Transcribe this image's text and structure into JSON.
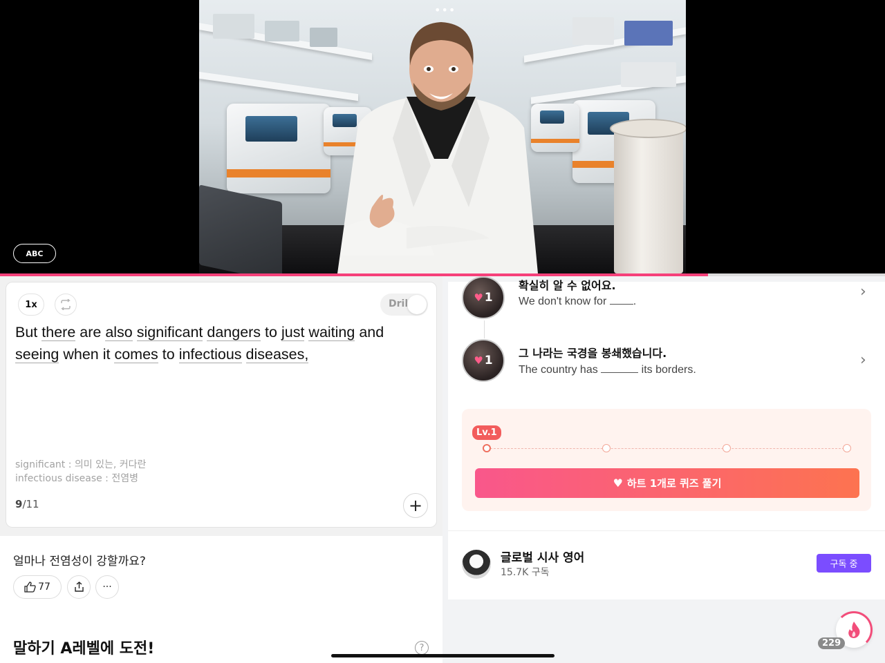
{
  "video": {
    "more_label": "•••",
    "abc_label": "ABC",
    "progress_percent": 80
  },
  "player": {
    "speed_label": "1x",
    "drill_label": "Drill",
    "sentence_words": [
      {
        "t": "But",
        "u": false
      },
      {
        "t": "there",
        "u": true
      },
      {
        "t": "are",
        "u": false
      },
      {
        "t": "also",
        "u": true
      },
      {
        "t": "significant",
        "u": true
      },
      {
        "t": "dangers",
        "u": true
      },
      {
        "t": "to",
        "u": false
      },
      {
        "t": "just",
        "u": true
      },
      {
        "t": "waiting",
        "u": true
      },
      {
        "t": "and",
        "u": false
      },
      {
        "t": "seeing",
        "u": true
      },
      {
        "t": "when",
        "u": false
      },
      {
        "t": "it",
        "u": false
      },
      {
        "t": "comes",
        "u": true
      },
      {
        "t": "to",
        "u": false
      },
      {
        "t": "infectious",
        "u": true
      },
      {
        "t": "diseases,",
        "u": true
      }
    ],
    "vocab": [
      "significant : 의미 있는, 커다란",
      "infectious disease : 전염병"
    ],
    "current_index": "9",
    "total": "/11"
  },
  "discussion": {
    "question": "얼마나 전염성이 강할까요?",
    "like_count": "77",
    "section_title": "말하기 A레벨에 도전!",
    "help_label": "?"
  },
  "quiz_items": [
    {
      "ko": "확실히 알 수 없어요.",
      "en_before": "We don't know for",
      "en_after": ".",
      "hearts": "1"
    },
    {
      "ko": "그 나라는 국경을 봉쇄했습니다.",
      "en_before": "The country has",
      "en_after": "its borders.",
      "hearts": "1"
    }
  ],
  "level": {
    "badge": "Lv.1",
    "button_label": "하트 1개로 퀴즈 풀기"
  },
  "channel": {
    "name": "글로벌 시사 영어",
    "subscribers": "15.7K 구독",
    "subscribe_label": "구독 중"
  },
  "streak": {
    "count": "229"
  },
  "colors": {
    "accent_pink": "#f6407a",
    "subscribe_purple": "#7b4dff"
  }
}
